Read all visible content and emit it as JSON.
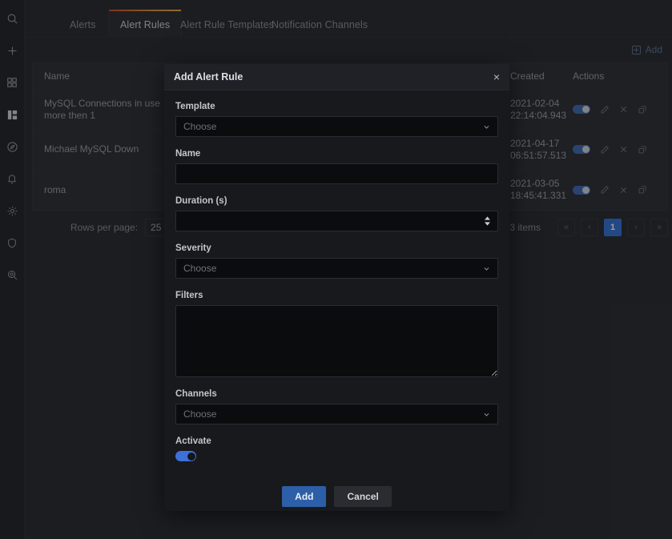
{
  "sidebar": {
    "items": [
      {
        "name": "search-icon",
        "label": "Search"
      },
      {
        "name": "plus-icon",
        "label": "Create"
      },
      {
        "name": "dashboards-grid-icon",
        "label": "Dashboards"
      },
      {
        "name": "panels-layout-icon",
        "label": "Panels",
        "active": true
      },
      {
        "name": "compass-explore-icon",
        "label": "Explore"
      },
      {
        "name": "bell-alerting-icon",
        "label": "Alerting"
      },
      {
        "name": "gear-configuration-icon",
        "label": "Configuration"
      },
      {
        "name": "shield-server-admin-icon",
        "label": "Server Admin"
      },
      {
        "name": "magnifier-search-icon",
        "label": "Query Analytics"
      }
    ]
  },
  "tabs": [
    {
      "label": "Alerts",
      "active": false
    },
    {
      "label": "Alert Rules",
      "active": true
    },
    {
      "label": "Alert Rule Templates",
      "active": false
    },
    {
      "label": "Notification Channels",
      "active": false
    }
  ],
  "toolbar": {
    "add_label": "Add"
  },
  "table": {
    "columns": [
      "Name",
      "Created",
      "Actions"
    ],
    "rows": [
      {
        "name": "MySQL Connections in use more then 1",
        "created": "2021-02-04 22:14:04.943",
        "enabled": true
      },
      {
        "name": "Michael MySQL Down",
        "created": "2021-04-17 06:51:57.513",
        "enabled": true
      },
      {
        "name": "roma",
        "created": "2021-03-05 18:45:41.331",
        "enabled": true
      }
    ],
    "row_actions": [
      "toggle",
      "edit-pencil-icon",
      "delete-x-icon",
      "duplicate-copy-icon"
    ]
  },
  "footer": {
    "rows_per_page_label": "Rows per page:",
    "rows_per_page_value": "25",
    "items_count": "3 items",
    "pager": {
      "first": "«",
      "prev": "‹",
      "current": "1",
      "next": "›",
      "last": "»"
    }
  },
  "modal": {
    "title": "Add Alert Rule",
    "close_label": "×",
    "fields": {
      "template": {
        "label": "Template",
        "placeholder": "Choose",
        "value": ""
      },
      "name": {
        "label": "Name",
        "placeholder": "",
        "value": ""
      },
      "duration": {
        "label": "Duration (s)",
        "placeholder": "",
        "value": ""
      },
      "severity": {
        "label": "Severity",
        "placeholder": "Choose",
        "value": ""
      },
      "filters": {
        "label": "Filters",
        "placeholder": "",
        "value": ""
      },
      "channels": {
        "label": "Channels",
        "placeholder": "Choose",
        "value": ""
      },
      "activate": {
        "label": "Activate",
        "on": true
      }
    },
    "buttons": {
      "submit": "Add",
      "cancel": "Cancel"
    }
  },
  "colors": {
    "page_bg": "#26282e",
    "panel_bg": "#2b2d33",
    "modal_bg": "#18191c",
    "accent_blue": "#3274d9",
    "tab_gradient_from": "#d44a27",
    "tab_gradient_to": "#eab14a",
    "toggle_on": "#3d71d9"
  }
}
